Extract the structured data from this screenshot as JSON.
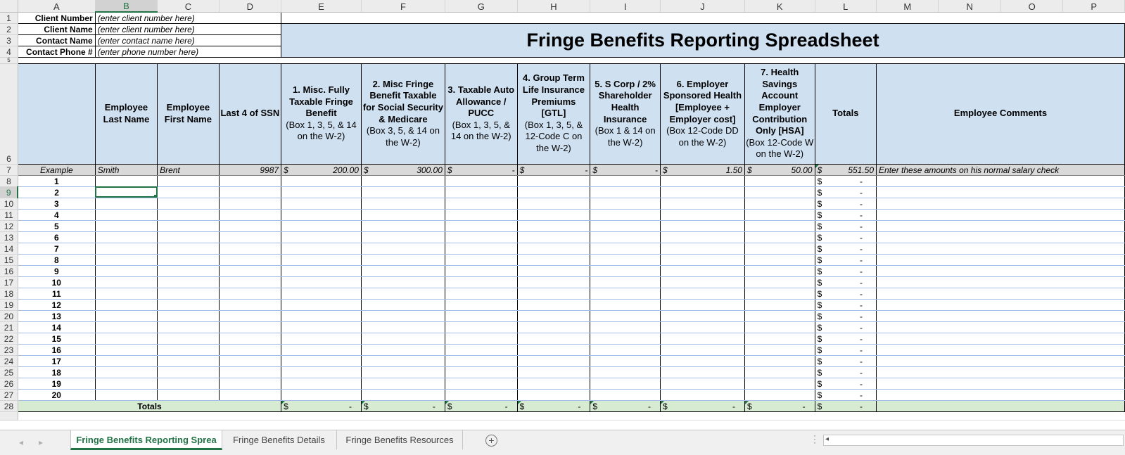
{
  "columns": [
    "A",
    "B",
    "C",
    "D",
    "E",
    "F",
    "G",
    "H",
    "I",
    "J",
    "K",
    "L",
    "M",
    "N",
    "O",
    "P"
  ],
  "selected_column": "B",
  "selected_row": "9",
  "info": [
    {
      "row": "1",
      "label": "Client Number",
      "value": "(enter client number here)"
    },
    {
      "row": "2",
      "label": "Client Name",
      "value": "(enter client number here)"
    },
    {
      "row": "3",
      "label": "Contact Name",
      "value": "(enter contact name here)"
    },
    {
      "row": "4",
      "label": "Contact Phone #",
      "value": "(enter phone number here)"
    }
  ],
  "title": "Fringe Benefits Reporting Spreadsheet",
  "row5": "5",
  "header_row": "6",
  "headers": {
    "last_name": "Employee Last Name",
    "first_name": "Employee First Name",
    "ssn": "Last 4 of SSN",
    "e_bold": "1. Misc. Fully Taxable Fringe Benefit",
    "e_note": "(Box 1, 3, 5, & 14 on the W-2)",
    "f_bold": "2. Misc Fringe Benefit Taxable for Social Security & Medicare",
    "f_note": "(Box 3, 5, & 14 on the W-2)",
    "g_bold": "3. Taxable Auto Allowance / PUCC",
    "g_note": "(Box 1, 3, 5, & 14 on the W-2)",
    "h_bold": "4. Group Term Life Insurance Premiums [GTL]",
    "h_note": "(Box 1, 3, 5, & 12-Code C on the W-2)",
    "i_bold": "5. S Corp / 2% Shareholder Health Insurance",
    "i_note": "(Box 1 & 14 on the W-2)",
    "j_bold": "6. Employer Sponsored Health [Employee + Employer cost]",
    "j_note": "(Box 12-Code DD on the W-2)",
    "k_bold": "7. Health Savings Account Employer Contribution Only [HSA]",
    "k_note": "(Box 12-Code W on the W-2)",
    "totals": "Totals",
    "comments": "Employee Comments"
  },
  "example": {
    "row": "7",
    "label": "Example",
    "last": "Smith",
    "first": "Brent",
    "ssn": "9987",
    "currency": "$",
    "e": "200.00",
    "f": "300.00",
    "g": "-",
    "h": "-",
    "i": "-",
    "j": "1.50",
    "k": "50.00",
    "total": "551.50",
    "comment": "Enter these amounts on his normal salary check"
  },
  "employee_rows": [
    {
      "row": "8",
      "num": "1",
      "total": "-"
    },
    {
      "row": "9",
      "num": "2",
      "total": "-"
    },
    {
      "row": "10",
      "num": "3",
      "total": "-"
    },
    {
      "row": "11",
      "num": "4",
      "total": "-"
    },
    {
      "row": "12",
      "num": "5",
      "total": "-"
    },
    {
      "row": "13",
      "num": "6",
      "total": "-"
    },
    {
      "row": "14",
      "num": "7",
      "total": "-"
    },
    {
      "row": "15",
      "num": "8",
      "total": "-"
    },
    {
      "row": "16",
      "num": "9",
      "total": "-"
    },
    {
      "row": "17",
      "num": "10",
      "total": "-"
    },
    {
      "row": "18",
      "num": "11",
      "total": "-"
    },
    {
      "row": "19",
      "num": "12",
      "total": "-"
    },
    {
      "row": "20",
      "num": "13",
      "total": "-"
    },
    {
      "row": "21",
      "num": "14",
      "total": "-"
    },
    {
      "row": "22",
      "num": "15",
      "total": "-"
    },
    {
      "row": "23",
      "num": "16",
      "total": "-"
    },
    {
      "row": "24",
      "num": "17",
      "total": "-"
    },
    {
      "row": "25",
      "num": "18",
      "total": "-"
    },
    {
      "row": "26",
      "num": "19",
      "total": "-"
    },
    {
      "row": "27",
      "num": "20",
      "total": "-"
    }
  ],
  "totals_row": {
    "row": "28",
    "label": "Totals",
    "value": "-"
  },
  "tabs": [
    "Fringe Benefits Reporting Sprea",
    "Fringe Benefits Details",
    "Fringe Benefits Resources"
  ],
  "active_tab": 0
}
